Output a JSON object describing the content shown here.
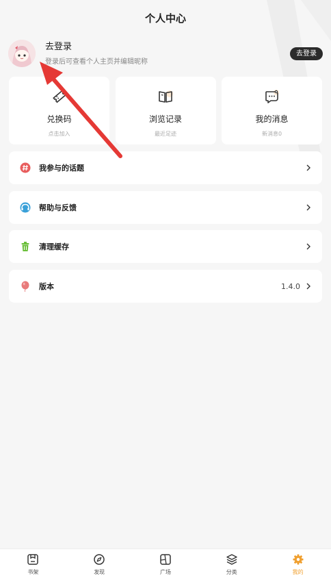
{
  "header": {
    "title": "个人中心"
  },
  "user": {
    "name": "去登录",
    "subtitle": "登录后可查看个人主页并编辑昵称",
    "login_button": "去登录"
  },
  "quick": [
    {
      "label": "兑换码",
      "sub": "点击加入",
      "icon": "ticket-icon"
    },
    {
      "label": "浏览记录",
      "sub": "最近足迹",
      "icon": "book-icon"
    },
    {
      "label": "我的消息",
      "sub": "新消息0",
      "icon": "message-icon"
    }
  ],
  "menu": [
    {
      "label": "我参与的话题",
      "value": "",
      "icon": "hashtag-icon",
      "color": "#e85d5d"
    },
    {
      "label": "帮助与反馈",
      "value": "",
      "icon": "help-icon",
      "color": "#3aa0d8"
    },
    {
      "label": "清理缓存",
      "value": "",
      "icon": "trash-icon",
      "color": "#6bbf3a"
    },
    {
      "label": "版本",
      "value": "1.4.0",
      "icon": "balloon-icon",
      "color": "#e87a7a"
    }
  ],
  "tabs": [
    {
      "label": "书架",
      "icon": "bookshelf-icon"
    },
    {
      "label": "发现",
      "icon": "compass-icon"
    },
    {
      "label": "广场",
      "icon": "square-icon"
    },
    {
      "label": "分类",
      "icon": "layers-icon"
    },
    {
      "label": "我的",
      "icon": "gear-icon"
    }
  ],
  "colors": {
    "accent": "#f0a030",
    "arrow": "#e53935",
    "dark_button": "#2b2b2b"
  }
}
